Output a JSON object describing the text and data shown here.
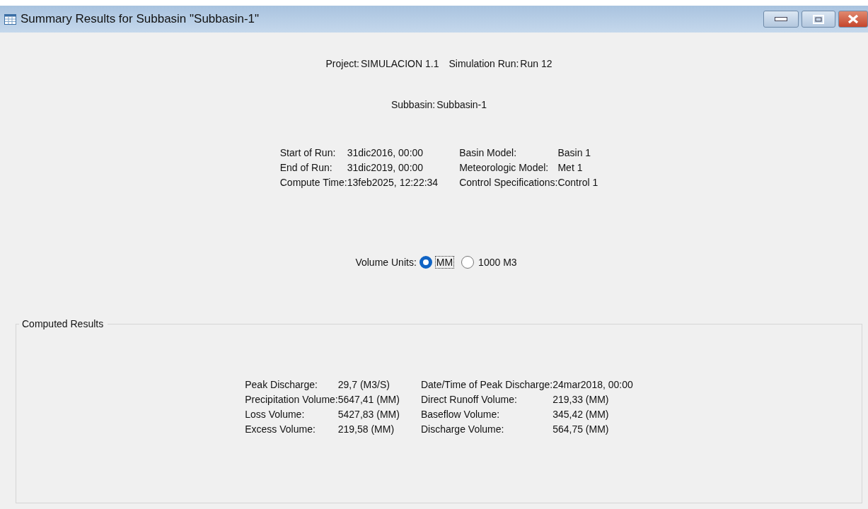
{
  "window": {
    "title": "Summary Results for Subbasin \"Subbasin-1\""
  },
  "header": {
    "project_label": "Project:",
    "project": "SIMULACION 1.1",
    "run_label": "Simulation Run:",
    "run": "Run 12",
    "subbasin_label": "Subbasin:",
    "subbasin": "Subbasin-1"
  },
  "run_info": [
    {
      "label": "Start of Run:",
      "value": "31dic2016, 00:00",
      "label_2": "Basin Model:",
      "value_2": "Basin 1"
    },
    {
      "label": "End of Run:",
      "value": "31dic2019, 00:00",
      "label_2": "Meteorologic Model:",
      "value_2": "Met 1"
    },
    {
      "label": "Compute Time:",
      "value": "13feb2025, 12:22:34",
      "label_2": "Control Specifications:",
      "value_2": "Control 1"
    }
  ],
  "volume_units": {
    "label": "Volume Units:",
    "options": [
      {
        "label": "MM",
        "selected": true,
        "focused": true
      },
      {
        "label": "1000 M3",
        "selected": false,
        "focused": false
      }
    ]
  },
  "computed_results": {
    "title": "Computed Results",
    "rows": [
      {
        "label": "Peak Discharge:",
        "value": "29,7 (M3/S)",
        "label_2": "Date/Time of Peak Discharge:",
        "value_2": "24mar2018, 00:00"
      },
      {
        "label": "Precipitation Volume:",
        "value": "5647,41 (MM)",
        "label_2": "Direct Runoff Volume:",
        "value_2": "219,33 (MM)"
      },
      {
        "label": "Loss Volume:",
        "value": "5427,83 (MM)",
        "label_2": "Baseflow Volume:",
        "value_2": "345,42 (MM)"
      },
      {
        "label": "Excess Volume:",
        "value": "219,58 (MM)",
        "label_2": "Discharge Volume:",
        "value_2": "564,75 (MM)"
      }
    ]
  }
}
